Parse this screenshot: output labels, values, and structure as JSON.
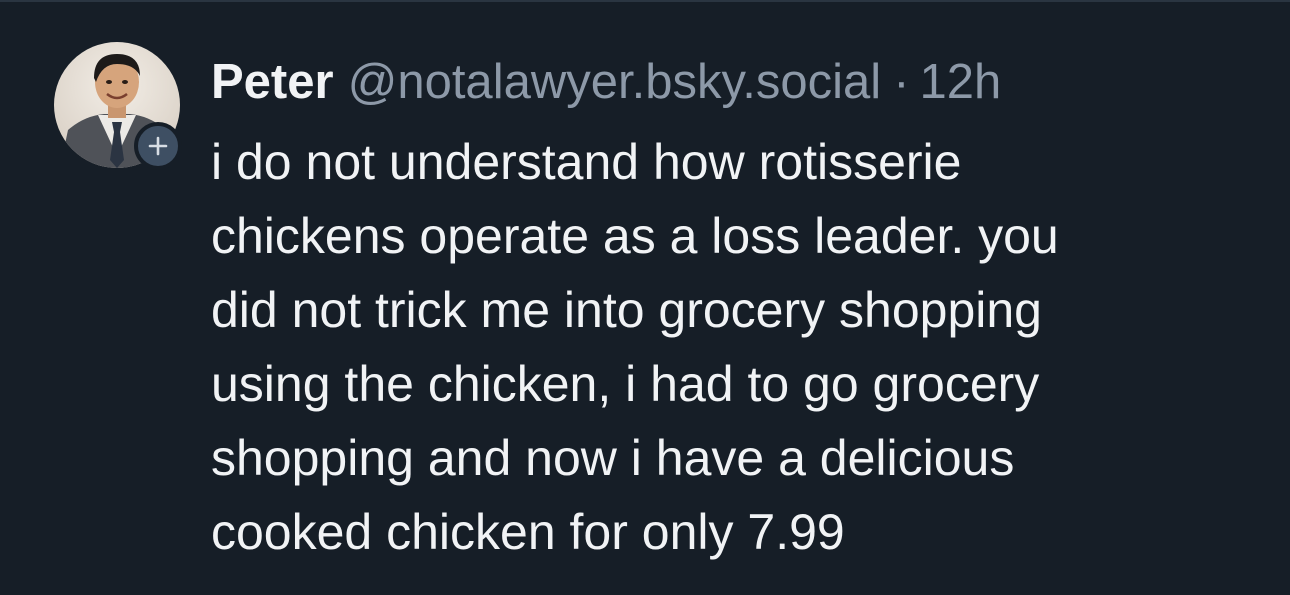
{
  "post": {
    "author": {
      "display_name": "Peter",
      "handle": "@notalawyer.bsky.social",
      "avatar_icon": "person-avatar-icon"
    },
    "separator": "·",
    "timestamp": "12h",
    "follow_icon": "plus-icon",
    "text_lines": [
      "i do not understand how rotisserie",
      "chickens operate as a loss leader. you",
      "did not trick me into grocery shopping",
      "using the chicken, i had to go grocery",
      "shopping and now i have a delicious",
      "cooked chicken for only 7.99"
    ]
  },
  "colors": {
    "background": "#161e27",
    "text_primary": "#f1f3f5",
    "text_secondary": "#8d99a8",
    "follow_badge": "#3e4f63"
  }
}
